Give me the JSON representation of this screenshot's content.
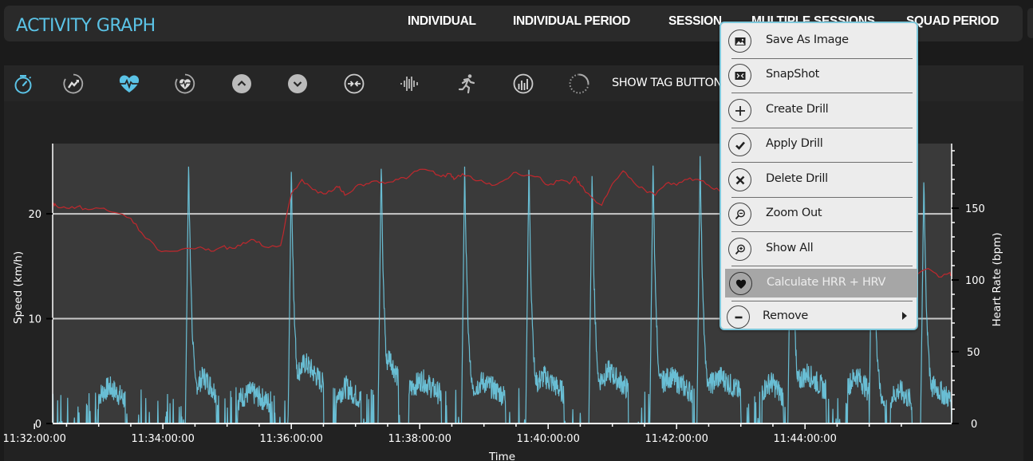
{
  "header": {
    "title": "ACTIVITY GRAPH",
    "nav": [
      {
        "label": "INDIVIDUAL"
      },
      {
        "label": "INDIVIDUAL PERIOD"
      },
      {
        "label": "SESSION"
      },
      {
        "label": "MULTIPLE SESSIONS"
      },
      {
        "label": "SQUAD PERIOD"
      }
    ]
  },
  "toolbar": {
    "icons": [
      {
        "name": "stopwatch-icon",
        "active": true
      },
      {
        "name": "trend-up-icon",
        "active": false
      },
      {
        "name": "heart-rate-icon",
        "active": true
      },
      {
        "name": "heart-circle-icon",
        "active": false
      },
      {
        "name": "chevron-up-icon",
        "active": false
      },
      {
        "name": "chevron-down-icon",
        "active": false
      },
      {
        "name": "collapse-arrows-icon",
        "active": false
      },
      {
        "name": "waveform-icon",
        "active": false
      },
      {
        "name": "runner-icon",
        "active": false
      },
      {
        "name": "bar-gauge-icon",
        "active": false
      },
      {
        "name": "loading-spinner-icon",
        "active": false
      }
    ],
    "show_tag_label": "SHOW TAG BUTTON"
  },
  "context_menu": {
    "items": [
      {
        "label": "Save As Image",
        "icon": "image-icon",
        "enabled": true
      },
      {
        "label": "SnapShot",
        "icon": "snapshot-icon",
        "enabled": true
      },
      {
        "label": "Create Drill",
        "icon": "plus-icon",
        "enabled": true
      },
      {
        "label": "Apply Drill",
        "icon": "check-icon",
        "enabled": true
      },
      {
        "label": "Delete Drill",
        "icon": "x-icon",
        "enabled": true
      },
      {
        "label": "Zoom Out",
        "icon": "zoom-out-icon",
        "enabled": true
      },
      {
        "label": "Show All",
        "icon": "zoom-in-icon",
        "enabled": true
      },
      {
        "label": "Calculate HRR + HRV",
        "icon": "heart-icon",
        "enabled": false
      },
      {
        "label": "Remove",
        "icon": "minus-icon",
        "enabled": true,
        "submenu": true
      }
    ]
  },
  "colors": {
    "accent": "#5bc3e6",
    "speed_line": "#6fcde6",
    "heart_rate_line": "#c0282d",
    "plot_bg": "#3a3a3a",
    "gridline": "#c8c8c8"
  },
  "chart_data": {
    "type": "line",
    "title": "",
    "xlabel": "Time",
    "ylabel": "Speed (km/h)",
    "y2label": "Heart Rate (bpm)",
    "x_ticks": [
      "11:32:00:00",
      "11:34:00:00",
      "11:36:00:00",
      "11:38:00:00",
      "11:40:00:00",
      "11:42:00:00",
      "11:44:00:00"
    ],
    "x_range_seconds": [
      77,
      917
    ],
    "x_origin": "11:31:00",
    "y_ticks": [
      0,
      10,
      20
    ],
    "ylim": [
      0,
      26.7
    ],
    "y2_ticks": [
      0,
      50,
      100,
      150
    ],
    "y2lim": [
      0,
      195
    ],
    "grid": "horizontal at speed 10 and 20",
    "legend": "none",
    "series": [
      {
        "name": "Heart Rate (bpm)",
        "axis": "right",
        "points_seconds": [
          77,
          80,
          90,
          100,
          110,
          125,
          135,
          150,
          160,
          175,
          190,
          205,
          215,
          225,
          235,
          245,
          255,
          265,
          275,
          290,
          300,
          310,
          320,
          330,
          340,
          345,
          350,
          360,
          370,
          380,
          390,
          400,
          410,
          420,
          430,
          440,
          448,
          452,
          460,
          470,
          480,
          490,
          500,
          510,
          520,
          530,
          540,
          550,
          560,
          565,
          570,
          580,
          590,
          600,
          610,
          620,
          630,
          640,
          650,
          660,
          670,
          680,
          690,
          700,
          710,
          720,
          727,
          735,
          745,
          750,
          760,
          770,
          780,
          790,
          800,
          810,
          815,
          825,
          835,
          845,
          855,
          865,
          875,
          885,
          895,
          905,
          915,
          917
        ],
        "values": [
          153,
          152,
          150,
          151,
          149,
          150,
          147,
          143,
          133,
          121,
          120,
          122,
          123,
          120,
          123,
          122,
          126,
          128,
          123,
          124,
          160,
          170,
          163,
          160,
          163,
          165,
          159,
          165,
          167,
          169,
          168,
          170,
          172,
          177,
          176,
          172,
          174,
          170,
          174,
          170,
          168,
          166,
          170,
          175,
          173,
          172,
          166,
          169,
          167,
          172,
          166,
          158,
          152,
          167,
          176,
          168,
          163,
          159,
          167,
          166,
          170,
          170,
          166,
          162,
          155,
          151,
          149,
          148,
          144,
          141,
          150,
          155,
          152,
          154,
          149,
          153,
          148,
          146,
          151,
          154,
          156,
          158,
          118,
          104,
          108,
          102,
          105,
          103
        ]
      },
      {
        "name": "Speed (km/h)",
        "axis": "left",
        "note": "noisy signal with ~15 sprint spikes reaching 20-25 km/h",
        "sprint_peaks": [
          {
            "t": 204,
            "v": 24.5
          },
          {
            "t": 300,
            "v": 24.0
          },
          {
            "t": 384,
            "v": 24.3
          },
          {
            "t": 462,
            "v": 24.5
          },
          {
            "t": 522,
            "v": 24.2
          },
          {
            "t": 581,
            "v": 23.6
          },
          {
            "t": 638,
            "v": 24.6
          },
          {
            "t": 682,
            "v": 25.5
          },
          {
            "t": 767,
            "v": 24.5
          },
          {
            "t": 843,
            "v": 24.4
          },
          {
            "t": 891,
            "v": 23.0
          }
        ],
        "bouts": [
          {
            "t0": 120,
            "t1": 145,
            "v": 3.5
          },
          {
            "t0": 210,
            "t1": 230,
            "v": 4.5
          },
          {
            "t0": 250,
            "t1": 280,
            "v": 3.0
          },
          {
            "t0": 302,
            "t1": 330,
            "v": 5.8
          },
          {
            "t0": 342,
            "t1": 365,
            "v": 3.5
          },
          {
            "t0": 386,
            "t1": 400,
            "v": 6.5
          },
          {
            "t0": 410,
            "t1": 440,
            "v": 4.2
          },
          {
            "t0": 465,
            "t1": 500,
            "v": 4.0
          },
          {
            "t0": 524,
            "t1": 555,
            "v": 4.5
          },
          {
            "t0": 585,
            "t1": 615,
            "v": 5.0
          },
          {
            "t0": 640,
            "t1": 675,
            "v": 4.5
          },
          {
            "t0": 688,
            "t1": 720,
            "v": 4.5
          },
          {
            "t0": 740,
            "t1": 760,
            "v": 4.0
          },
          {
            "t0": 770,
            "t1": 800,
            "v": 4.8
          },
          {
            "t0": 820,
            "t1": 840,
            "v": 4.7
          },
          {
            "t0": 860,
            "t1": 880,
            "v": 3.2
          },
          {
            "t0": 890,
            "t1": 917,
            "v": 3.5
          }
        ]
      }
    ]
  }
}
